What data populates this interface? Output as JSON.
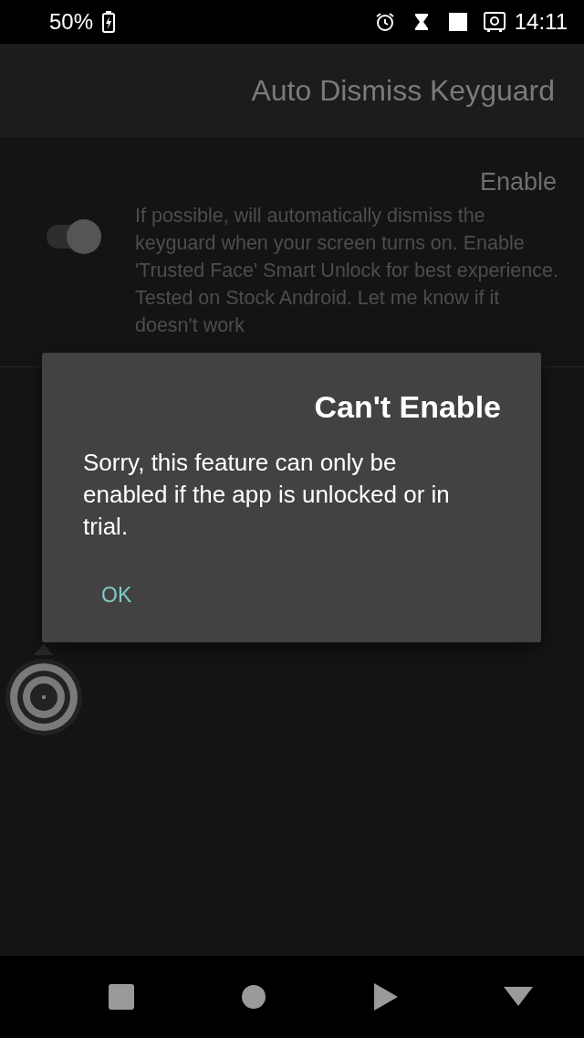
{
  "status_bar": {
    "battery": "50%",
    "time": "14:11"
  },
  "app_bar": {
    "title": "Auto Dismiss Keyguard"
  },
  "setting": {
    "title": "Enable",
    "description": "If possible, will automatically dismiss the keyguard when your screen turns on. Enable 'Trusted Face' Smart Unlock for best experience. Tested on Stock Android. Let me know if it doesn't work",
    "on": true
  },
  "dialog": {
    "title": "Can't Enable",
    "message": "Sorry, this feature can only be enabled if the app is unlocked or in trial.",
    "buttons": [
      "OK"
    ]
  }
}
